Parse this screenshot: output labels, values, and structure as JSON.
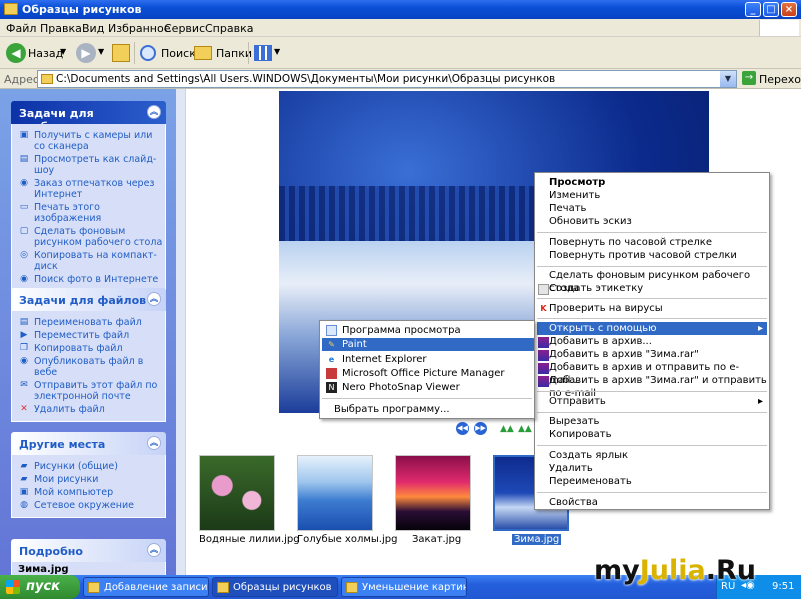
{
  "window": {
    "title": "Образцы рисунков"
  },
  "menubar": [
    "Файл",
    "Правка",
    "Вид",
    "Избранное",
    "Сервис",
    "Справка"
  ],
  "toolbar": {
    "back": "Назад",
    "search": "Поиск",
    "folders": "Папки"
  },
  "address": {
    "label": "Адрес:",
    "path": "C:\\Documents and Settings\\All Users.WINDOWS\\Документы\\Мои рисунки\\Образцы рисунков",
    "go": "Переход"
  },
  "sidebar": {
    "image_tasks": {
      "title": "Задачи для изображен",
      "items": [
        "Получить с камеры или со сканера",
        "Просмотреть как слайд-шоу",
        "Заказ отпечатков через Интернет",
        "Печать этого изображения",
        "Сделать фоновым рисунком рабочего стола",
        "Копировать на компакт-диск",
        "Поиск фото в Интернете"
      ]
    },
    "file_tasks": {
      "title": "Задачи для файлов и папок",
      "items": [
        "Переименовать файл",
        "Переместить файл",
        "Копировать файл",
        "Опубликовать файл в вебе",
        "Отправить этот файл по электронной почте",
        "Удалить файл"
      ]
    },
    "other_places": {
      "title": "Другие места",
      "items": [
        "Рисунки (общие)",
        "Мои рисунки",
        "Мой компьютер",
        "Сетевое окружение"
      ]
    },
    "details": {
      "title": "Подробно",
      "filename": "Зима.jpg"
    }
  },
  "thumbnails": [
    {
      "name": "Водяные лилии.jpg",
      "selected": false
    },
    {
      "name": "Голубые холмы.jpg",
      "selected": false
    },
    {
      "name": "Закат.jpg",
      "selected": false
    },
    {
      "name": "Зима.jpg",
      "selected": true
    }
  ],
  "context_menu": {
    "items": [
      "Просмотр",
      "Изменить",
      "Печать",
      "Обновить эскиз",
      "Повернуть по часовой стрелке",
      "Повернуть против часовой стрелки",
      "Сделать фоновым рисунком рабочего стола",
      "Создать этикетку",
      "Проверить на вирусы",
      "Открыть с помощью",
      "Добавить в архив...",
      "Добавить в архив \"Зима.rar\"",
      "Добавить в архив и отправить по e-mail...",
      "Добавить в архив \"Зима.rar\" и отправить по e-mail",
      "Отправить",
      "Вырезать",
      "Копировать",
      "Создать ярлык",
      "Удалить",
      "Переименовать",
      "Свойства"
    ]
  },
  "open_with_menu": {
    "items": [
      "Программа просмотра изображений и факсов",
      "Paint",
      "Internet Explorer",
      "Microsoft Office Picture Manager",
      "Nero PhotoSnap Viewer",
      "Выбрать программу..."
    ]
  },
  "taskbar": {
    "start": "пуск",
    "tasks": [
      "Добавление записи ...",
      "Образцы рисунков",
      "Уменьшение картинок"
    ],
    "lang": "RU",
    "clock": "9:51"
  },
  "watermark": {
    "prefix": "my",
    "highlight": "Julia",
    "suffix": ".Ru"
  },
  "colors": {
    "xp_blue": "#0a4fd6",
    "selection": "#316ac5",
    "sidebar": "#6375d6"
  }
}
